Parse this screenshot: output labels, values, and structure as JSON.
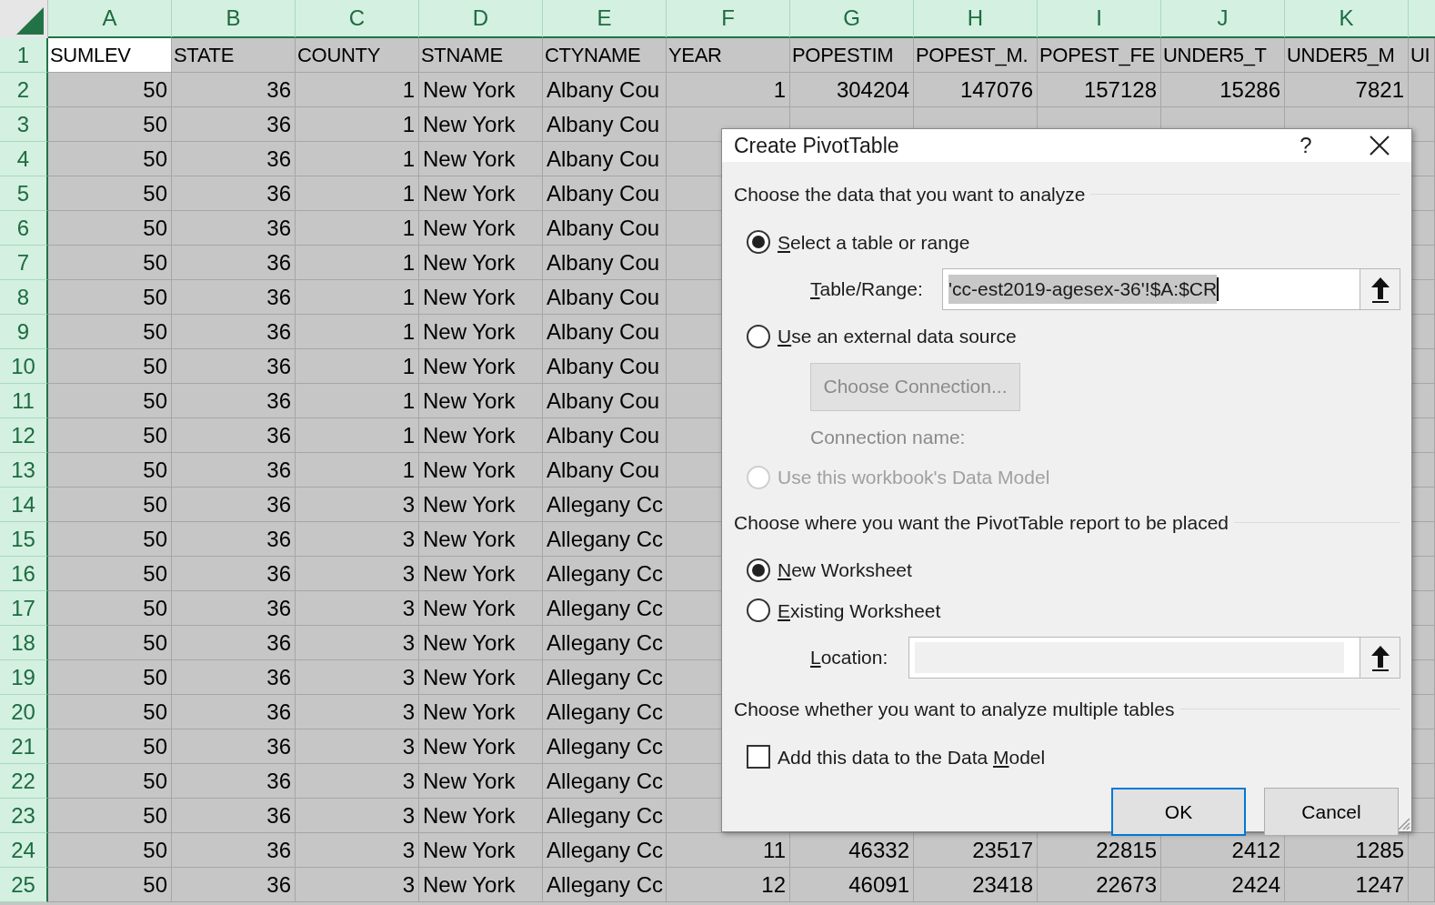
{
  "sheet": {
    "columns": [
      {
        "letter": "A",
        "kind": "number",
        "active": true
      },
      {
        "letter": "B",
        "kind": "number",
        "active": false
      },
      {
        "letter": "C",
        "kind": "number",
        "active": false
      },
      {
        "letter": "D",
        "kind": "text",
        "active": false
      },
      {
        "letter": "E",
        "kind": "text",
        "active": false
      },
      {
        "letter": "F",
        "kind": "number",
        "active": false
      },
      {
        "letter": "G",
        "kind": "number",
        "active": false
      },
      {
        "letter": "H",
        "kind": "number",
        "active": false
      },
      {
        "letter": "I",
        "kind": "number",
        "active": false
      },
      {
        "letter": "J",
        "kind": "number",
        "active": false
      },
      {
        "letter": "K",
        "kind": "number",
        "active": false
      }
    ],
    "rows": [
      {
        "number": "1",
        "kind": "header",
        "active": true,
        "cells": [
          "SUMLEV",
          "STATE",
          "COUNTY",
          "STNAME",
          "CTYNAME",
          "YEAR",
          "POPESTIM",
          "POPEST_M.",
          "POPEST_FE",
          "UNDER5_T",
          "UNDER5_M",
          "UI"
        ]
      },
      {
        "number": "2",
        "kind": "data",
        "cells": [
          "50",
          "36",
          "1",
          "New York",
          "Albany Cou",
          "1",
          "304204",
          "147076",
          "157128",
          "15286",
          "7821"
        ]
      },
      {
        "number": "3",
        "kind": "data",
        "cells": [
          "50",
          "36",
          "1",
          "New York",
          "Albany Cou"
        ]
      },
      {
        "number": "4",
        "kind": "data",
        "cells": [
          "50",
          "36",
          "1",
          "New York",
          "Albany Cou"
        ]
      },
      {
        "number": "5",
        "kind": "data",
        "cells": [
          "50",
          "36",
          "1",
          "New York",
          "Albany Cou"
        ]
      },
      {
        "number": "6",
        "kind": "data",
        "cells": [
          "50",
          "36",
          "1",
          "New York",
          "Albany Cou"
        ]
      },
      {
        "number": "7",
        "kind": "data",
        "cells": [
          "50",
          "36",
          "1",
          "New York",
          "Albany Cou"
        ]
      },
      {
        "number": "8",
        "kind": "data",
        "cells": [
          "50",
          "36",
          "1",
          "New York",
          "Albany Cou"
        ]
      },
      {
        "number": "9",
        "kind": "data",
        "cells": [
          "50",
          "36",
          "1",
          "New York",
          "Albany Cou"
        ]
      },
      {
        "number": "10",
        "kind": "data",
        "cells": [
          "50",
          "36",
          "1",
          "New York",
          "Albany Cou"
        ]
      },
      {
        "number": "11",
        "kind": "data",
        "cells": [
          "50",
          "36",
          "1",
          "New York",
          "Albany Cou"
        ]
      },
      {
        "number": "12",
        "kind": "data",
        "cells": [
          "50",
          "36",
          "1",
          "New York",
          "Albany Cou"
        ]
      },
      {
        "number": "13",
        "kind": "data",
        "cells": [
          "50",
          "36",
          "1",
          "New York",
          "Albany Cou"
        ]
      },
      {
        "number": "14",
        "kind": "data",
        "cells": [
          "50",
          "36",
          "3",
          "New York",
          "Allegany Cc"
        ]
      },
      {
        "number": "15",
        "kind": "data",
        "cells": [
          "50",
          "36",
          "3",
          "New York",
          "Allegany Cc"
        ]
      },
      {
        "number": "16",
        "kind": "data",
        "cells": [
          "50",
          "36",
          "3",
          "New York",
          "Allegany Cc"
        ]
      },
      {
        "number": "17",
        "kind": "data",
        "cells": [
          "50",
          "36",
          "3",
          "New York",
          "Allegany Cc"
        ]
      },
      {
        "number": "18",
        "kind": "data",
        "cells": [
          "50",
          "36",
          "3",
          "New York",
          "Allegany Cc"
        ]
      },
      {
        "number": "19",
        "kind": "data",
        "cells": [
          "50",
          "36",
          "3",
          "New York",
          "Allegany Cc"
        ]
      },
      {
        "number": "20",
        "kind": "data",
        "cells": [
          "50",
          "36",
          "3",
          "New York",
          "Allegany Cc"
        ]
      },
      {
        "number": "21",
        "kind": "data",
        "cells": [
          "50",
          "36",
          "3",
          "New York",
          "Allegany Cc"
        ]
      },
      {
        "number": "22",
        "kind": "data",
        "cells": [
          "50",
          "36",
          "3",
          "New York",
          "Allegany Cc"
        ]
      },
      {
        "number": "23",
        "kind": "data",
        "cells": [
          "50",
          "36",
          "3",
          "New York",
          "Allegany Cc"
        ]
      },
      {
        "number": "24",
        "kind": "data",
        "cells": [
          "50",
          "36",
          "3",
          "New York",
          "Allegany Cc",
          "11",
          "46332",
          "23517",
          "22815",
          "2412",
          "1285"
        ]
      },
      {
        "number": "25",
        "kind": "data",
        "cells": [
          "50",
          "36",
          "3",
          "New York",
          "Allegany Cc",
          "12",
          "46091",
          "23418",
          "22673",
          "2424",
          "1247"
        ]
      }
    ]
  },
  "dialog": {
    "title": "Create PivotTable",
    "help": "?",
    "sections": [
      {
        "heading": "Choose the data that you want to analyze",
        "items": [
          {
            "kind": "radio",
            "access_key": "S",
            "label_rest": "elect a table or range",
            "selected": true,
            "disabled": false
          },
          {
            "kind": "field",
            "access_key": "T",
            "label_rest": "able/Range:",
            "value": "'cc-est2019-agesex-36'!$A:$CR",
            "value_selected": true
          },
          {
            "kind": "radio",
            "access_key": "U",
            "label_rest": "se an external data source",
            "selected": false,
            "disabled": false
          },
          {
            "kind": "button",
            "label": "Choose Connection...",
            "disabled": true
          },
          {
            "kind": "note",
            "label": "Connection name:",
            "disabled": true
          },
          {
            "kind": "radio",
            "label": "Use this workbook's Data Model",
            "selected": false,
            "disabled": true
          }
        ]
      },
      {
        "heading": "Choose where you want the PivotTable report to be placed",
        "items": [
          {
            "kind": "radio",
            "access_key": "N",
            "label_rest": "ew Worksheet",
            "selected": true,
            "disabled": false
          },
          {
            "kind": "radio",
            "access_key": "E",
            "label_rest": "xisting Worksheet",
            "selected": false,
            "disabled": false
          },
          {
            "kind": "field",
            "access_key": "L",
            "label_rest": "ocation:"
          }
        ]
      },
      {
        "heading": "Choose whether you want to analyze multiple tables",
        "items": [
          {
            "kind": "checkbox",
            "label": "Add this data to the Data ",
            "access_key": "M",
            "label_rest": "odel",
            "checked": false
          }
        ]
      }
    ],
    "buttons": [
      {
        "label": "OK",
        "default": true
      },
      {
        "label": "Cancel",
        "default": false
      }
    ]
  }
}
